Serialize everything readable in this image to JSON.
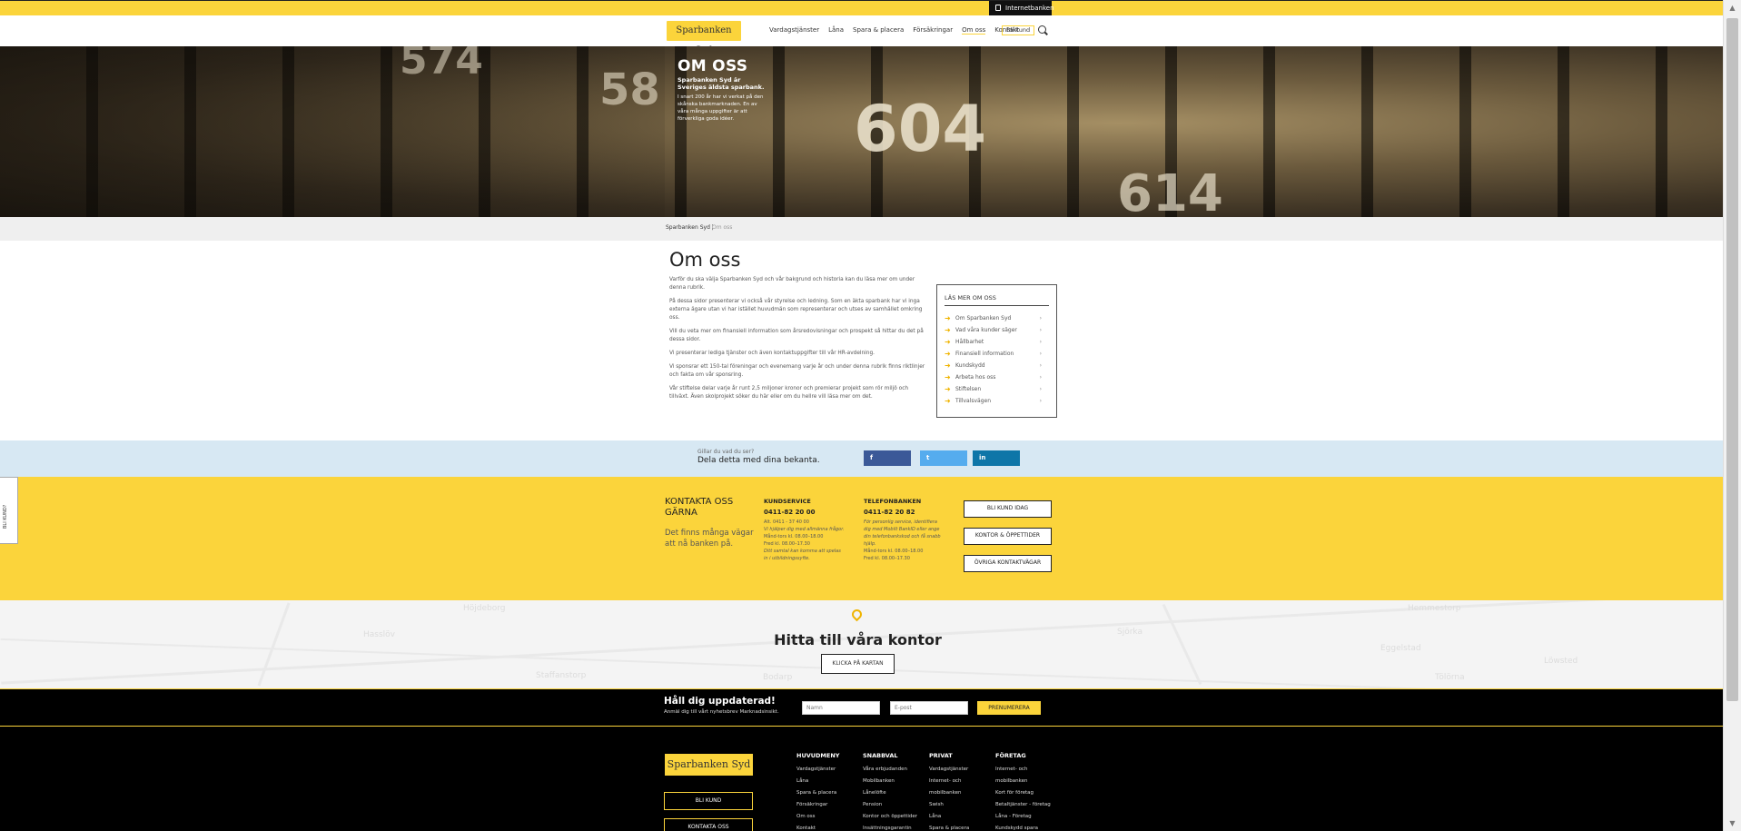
{
  "topbar": {
    "internetbank_label": "Internetbanken"
  },
  "header": {
    "logo": "Sparbanken Syd",
    "nav": [
      "Vardagstjänster",
      "Låna",
      "Spara & placera",
      "Försäkringar",
      "Om oss",
      "Kontakt"
    ],
    "bli_kund": "Bli kund"
  },
  "hero": {
    "title": "OM OSS",
    "subtitle": "Sparbanken Syd är Sveriges äldsta sparbank.",
    "body": "I snart 200 år har vi verkat på den skånska bankmarknaden. En av våra många uppgifter är att förverkliga goda idéer."
  },
  "breadcrumb": {
    "home": "Sparbanken Syd |",
    "current": "Om oss"
  },
  "main": {
    "title": "Om oss",
    "paragraphs": [
      "Varför du ska välja Sparbanken Syd och vår bakgrund och historia kan du läsa mer om under denna rubrik.",
      "På dessa sidor presenterar vi också vår styrelse och ledning. Som en äkta sparbank har vi inga externa ägare utan vi har istället huvudmän som representerar och utses av samhället omkring oss.",
      "Vill du veta mer om finansiell information som årsredovisningar och prospekt så hittar du det på dessa sidor.",
      "Vi presenterar lediga tjänster och även kontaktuppgifter till vår HR-avdelning.",
      "Vi sponsrar ett 150-tal föreningar och evenemang varje år och under denna rubrik finns riktlinjer och fakta om vår sponsring.",
      "Vår stiftelse delar varje år runt 2,5 miljoner kronor och premierar projekt som rör miljö och tillväxt. Även skolprojekt söker du här eller om du hellre vill läsa mer om det."
    ]
  },
  "sidebox": {
    "heading": "LÄS MER OM OSS",
    "items": [
      "Om Sparbanken Syd",
      "Vad våra kunder säger",
      "Hållbarhet",
      "Finansiell information",
      "Kundskydd",
      "Arbeta hos oss",
      "Stiftelsen",
      "Tillvalsvägen"
    ]
  },
  "share": {
    "question": "Gillar du vad du ser?",
    "title": "Dela detta med dina bekanta.",
    "facebook": "f",
    "twitter": "t",
    "linkedin": "in"
  },
  "contact": {
    "side_tab": "BLI KUND?",
    "title": "KONTAKTA OSS GÄRNA",
    "desc": "Det finns många vägar att nå banken på.",
    "kundservice": {
      "heading": "KUNDSERVICE",
      "number": "0411-82 20 00",
      "line1": "Alt. 0411 - 37 40 00",
      "line2": "Vi hjälper dig med allmänna frågor.",
      "line3": "Månd-tors kl. 08.00–18.00",
      "line4": "Fred kl. 08.00–17.30",
      "line5": "Ditt samtal kan komma att spelas in i utbildningssyfte."
    },
    "telefonbanken": {
      "heading": "TELEFONBANKEN",
      "number": "0411-82 20 82",
      "line1": "För personlig service, identifiera dig med Mobilt BankID eller ange din telefonbankskod och få snabb hjälp.",
      "line2": "Månd-tors kl. 08.00–18.00",
      "line3": "Fred kl. 08.00–17.30"
    },
    "buttons": [
      "BLI KUND IDAG",
      "KONTOR & ÖPPETTIDER",
      "ÖVRIGA KONTAKTVÄGAR"
    ]
  },
  "map": {
    "title": "Hitta till våra kontor",
    "button": "KLICKA PÅ KARTAN",
    "towns": [
      "Höjdeborg",
      "Hasslöv",
      "Staffanstorp",
      "Bodarp",
      "Hemmestorp",
      "Sjörka",
      "Eggelstad",
      "Löwsted",
      "Tölörna"
    ]
  },
  "newsletter": {
    "title": "Håll dig uppdaterad!",
    "subtitle": "Anmäl dig till vårt nyhetsbrev Marknadsinsikt.",
    "name_placeholder": "Namn",
    "email_placeholder": "E-post",
    "submit": "PRENUMERERA"
  },
  "footer": {
    "logo": "Sparbanken Syd",
    "button1": "BLI KUND",
    "button2": "KONTAKTA OSS",
    "columns": [
      {
        "heading": "HUVUDMENY",
        "links": [
          "Vardagstjänster",
          "Låna",
          "Spara & placera",
          "Försäkringar",
          "Om oss",
          "Kontakt"
        ]
      },
      {
        "heading": "SNABBVAL",
        "links": [
          "Våra erbjudanden",
          "Mobilbanken",
          "Lånelöfte",
          "Pension",
          "Kontor och öppettider",
          "Insättningsgarantin"
        ]
      },
      {
        "heading": "PRIVAT",
        "links": [
          "Vardagstjänster",
          "Internet- och",
          "mobilbanken",
          "Swish",
          "Låna",
          "Spara & placera"
        ]
      },
      {
        "heading": "FÖRETAG",
        "links": [
          "Internet- och",
          "mobilbanken",
          "Kort för företag",
          "Betaltjänster - företag",
          "Låna - Företag",
          "Kundskydd spara"
        ]
      }
    ]
  }
}
